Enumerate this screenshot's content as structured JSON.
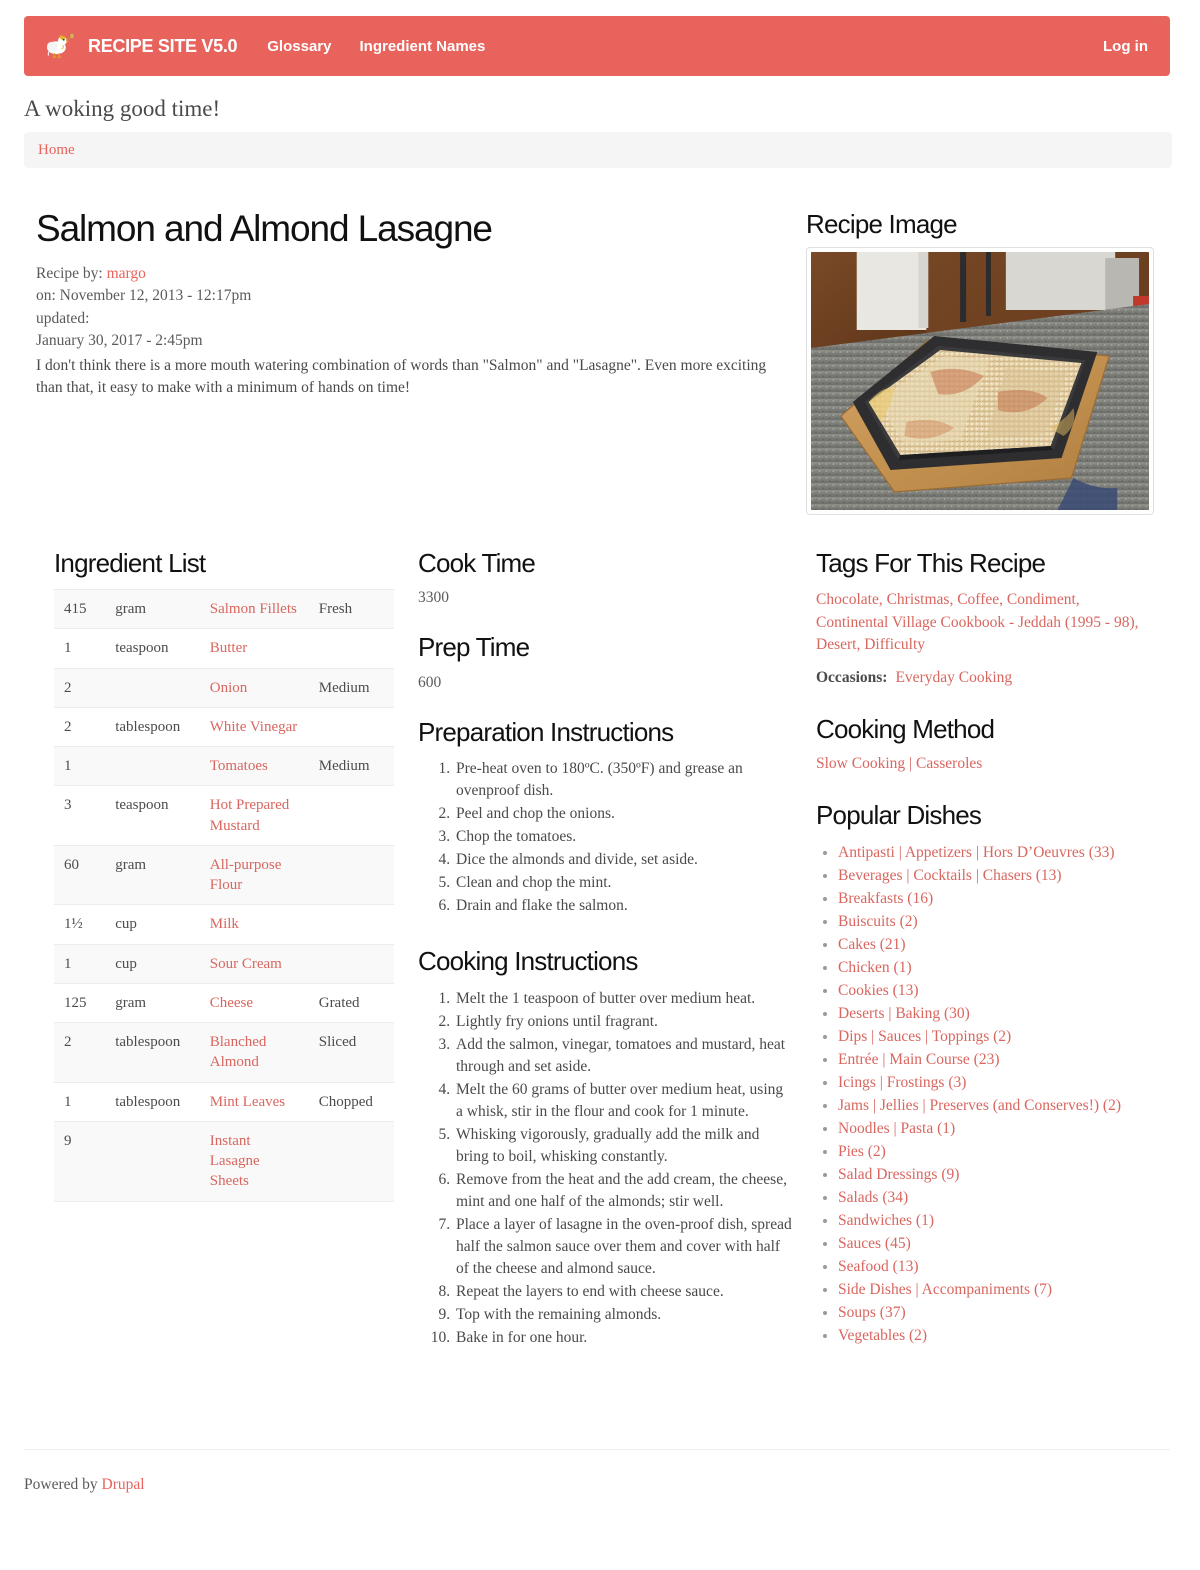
{
  "header": {
    "logo_icon": "rooster-with-spoon-icon",
    "brand": "RECIPE SITE V5.0",
    "nav": [
      {
        "label": "Glossary"
      },
      {
        "label": "Ingredient Names"
      }
    ],
    "login_label": "Log in",
    "brand_color": "#e8635c"
  },
  "slogan": "A woking good time!",
  "breadcrumb": {
    "home_label": "Home"
  },
  "recipe": {
    "title": "Salmon and Almond Lasagne",
    "by_label": "Recipe by:",
    "author": "margo",
    "posted": "on: November 12, 2013 - 12:17pm",
    "updated_label": "updated:",
    "updated": "January 30, 2017 - 2:45pm",
    "description": "I don't think there is a more mouth watering combination of words than \"Salmon\" and \"Lasagne\". Even more exciting than that, it easy to make with a minimum of hands on time!"
  },
  "image_section": {
    "heading": "Recipe Image",
    "alt": "Baked salmon and almond lasagne in a dark rectangular tray resting on a wooden chopping board on a speckled grey countertop"
  },
  "ingredients": {
    "heading": "Ingredient List",
    "rows": [
      {
        "qty": "415",
        "unit": "gram",
        "name": "Salmon Fillets",
        "note": "Fresh"
      },
      {
        "qty": "1",
        "unit": "teaspoon",
        "name": "Butter",
        "note": ""
      },
      {
        "qty": "2",
        "unit": "",
        "name": "Onion",
        "note": "Medium"
      },
      {
        "qty": "2",
        "unit": "tablespoon",
        "name": "White Vinegar",
        "note": ""
      },
      {
        "qty": "1",
        "unit": "",
        "name": "Tomatoes",
        "note": "Medium"
      },
      {
        "qty": "3",
        "unit": "teaspoon",
        "name": "Hot Prepared Mustard",
        "note": ""
      },
      {
        "qty": "60",
        "unit": "gram",
        "name": "All-purpose Flour",
        "note": ""
      },
      {
        "qty": "1½",
        "unit": "cup",
        "name": "Milk",
        "note": ""
      },
      {
        "qty": "1",
        "unit": "cup",
        "name": "Sour Cream",
        "note": ""
      },
      {
        "qty": "125",
        "unit": "gram",
        "name": "Cheese",
        "note": "Grated"
      },
      {
        "qty": "2",
        "unit": "tablespoon",
        "name": "Blanched Almond",
        "note": "Sliced"
      },
      {
        "qty": "1",
        "unit": "tablespoon",
        "name": "Mint Leaves",
        "note": "Chopped"
      },
      {
        "qty": "9",
        "unit": "",
        "name": "Instant Lasagne Sheets",
        "note": ""
      }
    ]
  },
  "cook_time": {
    "heading": "Cook Time",
    "value": "3300"
  },
  "prep_time": {
    "heading": "Prep Time",
    "value": "600"
  },
  "preparation": {
    "heading": "Preparation Instructions",
    "steps": [
      "Pre-heat oven to 180ºC. (350ºF) and grease an ovenproof dish.",
      "Peel and chop the onions.",
      "Chop the tomatoes.",
      "Dice the almonds and divide, set aside.",
      "Clean and chop the mint.",
      "Drain and flake the salmon."
    ]
  },
  "cooking": {
    "heading": "Cooking Instructions",
    "steps": [
      "Melt the 1 teaspoon of butter over medium heat.",
      "Lightly fry onions until fragrant.",
      "Add the salmon, vinegar, tomatoes and mustard, heat through and set aside.",
      "Melt the 60 grams of butter over medium heat, using a whisk, stir in the flour and cook for 1 minute.",
      "Whisking vigorously, gradually add the milk and bring to boil, whisking constantly.",
      "Remove from the heat and the add cream, the cheese, mint and one half of the almonds; stir well.",
      "Place a layer of lasagne in the oven-proof dish, spread half the salmon sauce over them and cover with half of the cheese and almond sauce.",
      "Repeat the layers to end with cheese sauce.",
      "Top with the remaining almonds.",
      "Bake in for one hour."
    ]
  },
  "tags": {
    "heading": "Tags For This Recipe",
    "items": [
      "Chocolate",
      "Christmas",
      "Coffee",
      "Condiment",
      "Continental Village Cookbook - Jeddah (1995 - 98)",
      "Desert",
      "Difficulty"
    ],
    "occasions_label": "Occasions:",
    "occasions_value": "Everyday Cooking"
  },
  "cooking_method": {
    "heading": "Cooking Method",
    "value": "Slow Cooking | Casseroles"
  },
  "popular_dishes": {
    "heading": "Popular Dishes",
    "items": [
      "Antipasti | Appetizers | Hors D’Oeuvres (33)",
      "Beverages | Cocktails | Chasers (13)",
      "Breakfasts (16)",
      "Buiscuits (2)",
      "Cakes (21)",
      "Chicken (1)",
      "Cookies (13)",
      "Deserts | Baking (30)",
      "Dips | Sauces | Toppings (2)",
      "Entrée | Main Course (23)",
      "Icings | Frostings (3)",
      "Jams | Jellies | Preserves (and Conserves!) (2)",
      "Noodles | Pasta (1)",
      "Pies (2)",
      "Salad Dressings (9)",
      "Salads (34)",
      "Sandwiches (1)",
      "Sauces (45)",
      "Seafood (13)",
      "Side Dishes | Accompaniments (7)",
      "Soups (37)",
      "Vegetables (2)"
    ]
  },
  "footer": {
    "powered_by": "Powered by",
    "platform": "Drupal"
  }
}
